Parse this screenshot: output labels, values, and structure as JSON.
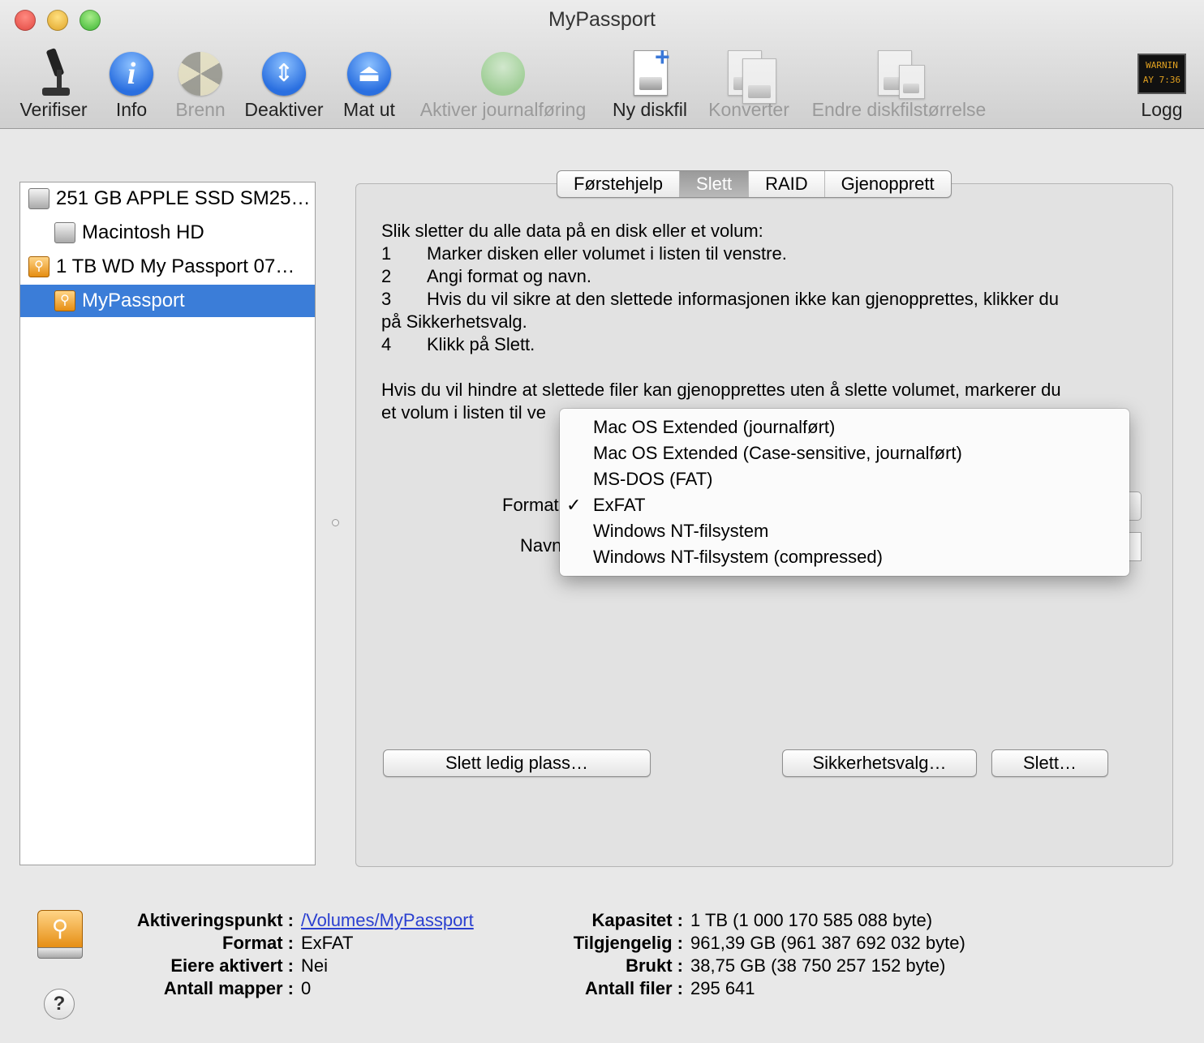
{
  "window": {
    "title": "MyPassport"
  },
  "toolbar": {
    "verify": "Verifiser",
    "info": "Info",
    "burn": "Brenn",
    "unmount": "Deaktiver",
    "eject": "Mat ut",
    "enable_journaling": "Aktiver journalføring",
    "new_image": "Ny diskfil",
    "convert": "Konverter",
    "resize_image": "Endre diskfilstørrelse",
    "log": "Logg",
    "log_screen_line1": "WARNIN",
    "log_screen_line2": "AY 7:36"
  },
  "sidebar": {
    "items": [
      {
        "label": "251 GB APPLE SSD SM25…",
        "icon": "internal-disk-icon"
      },
      {
        "label": "Macintosh HD",
        "icon": "internal-volume-icon"
      },
      {
        "label": "1 TB WD My Passport 07…",
        "icon": "external-usb-disk-icon"
      },
      {
        "label": "MyPassport",
        "icon": "external-usb-volume-icon",
        "selected": true
      }
    ]
  },
  "tabs": [
    {
      "label": "Førstehjelp"
    },
    {
      "label": "Slett",
      "active": true
    },
    {
      "label": "RAID"
    },
    {
      "label": "Gjenopprett"
    }
  ],
  "erase": {
    "heading": "Slik sletter du alle data på en disk eller et volum:",
    "steps": [
      {
        "num": "1",
        "text": "Marker disken eller volumet i listen til venstre."
      },
      {
        "num": "2",
        "text": "Angi format og navn."
      },
      {
        "num": "3",
        "text": "Hvis du vil sikre at den slettede informasjonen ikke kan gjenopprettes, klikker du"
      },
      {
        "num": "",
        "text": "på Sikkerhetsvalg."
      },
      {
        "num": "4",
        "text": "Klikk på Slett."
      }
    ],
    "note_line1": "Hvis du vil hindre at slettede filer kan gjenopprettes uten å slette volumet, markerer du",
    "note_line2": "et volum i listen til ve",
    "format_label": "Format",
    "name_label": "Navn",
    "format_options": [
      {
        "label": "Mac OS Extended (journalført)",
        "checked": false
      },
      {
        "label": "Mac OS Extended (Case-sensitive, journalført)",
        "checked": false
      },
      {
        "label": "MS-DOS (FAT)",
        "checked": false
      },
      {
        "label": "ExFAT",
        "checked": true
      },
      {
        "label": "Windows NT-filsystem",
        "checked": false
      },
      {
        "label": "Windows NT-filsystem (compressed)",
        "checked": false
      }
    ],
    "check_mark": "✓",
    "erase_free_space_button": "Slett ledig plass…",
    "security_options_button": "Sikkerhetsvalg…",
    "erase_button": "Slett…"
  },
  "info": {
    "mount_point_key": "Aktiveringspunkt :",
    "mount_point_value": "/Volumes/MyPassport",
    "format_key": "Format :",
    "format_value": "ExFAT",
    "owners_key": "Eiere aktivert :",
    "owners_value": "Nei",
    "folders_key": "Antall mapper :",
    "folders_value": "0",
    "capacity_key": "Kapasitet :",
    "capacity_value": "1 TB (1 000 170 585 088 byte)",
    "available_key": "Tilgjengelig :",
    "available_value": "961,39 GB (961 387 692 032 byte)",
    "used_key": "Brukt :",
    "used_value": "38,75 GB (38 750 257 152 byte)",
    "files_key": "Antall filer :",
    "files_value": "295 641"
  },
  "help_glyph": "?"
}
